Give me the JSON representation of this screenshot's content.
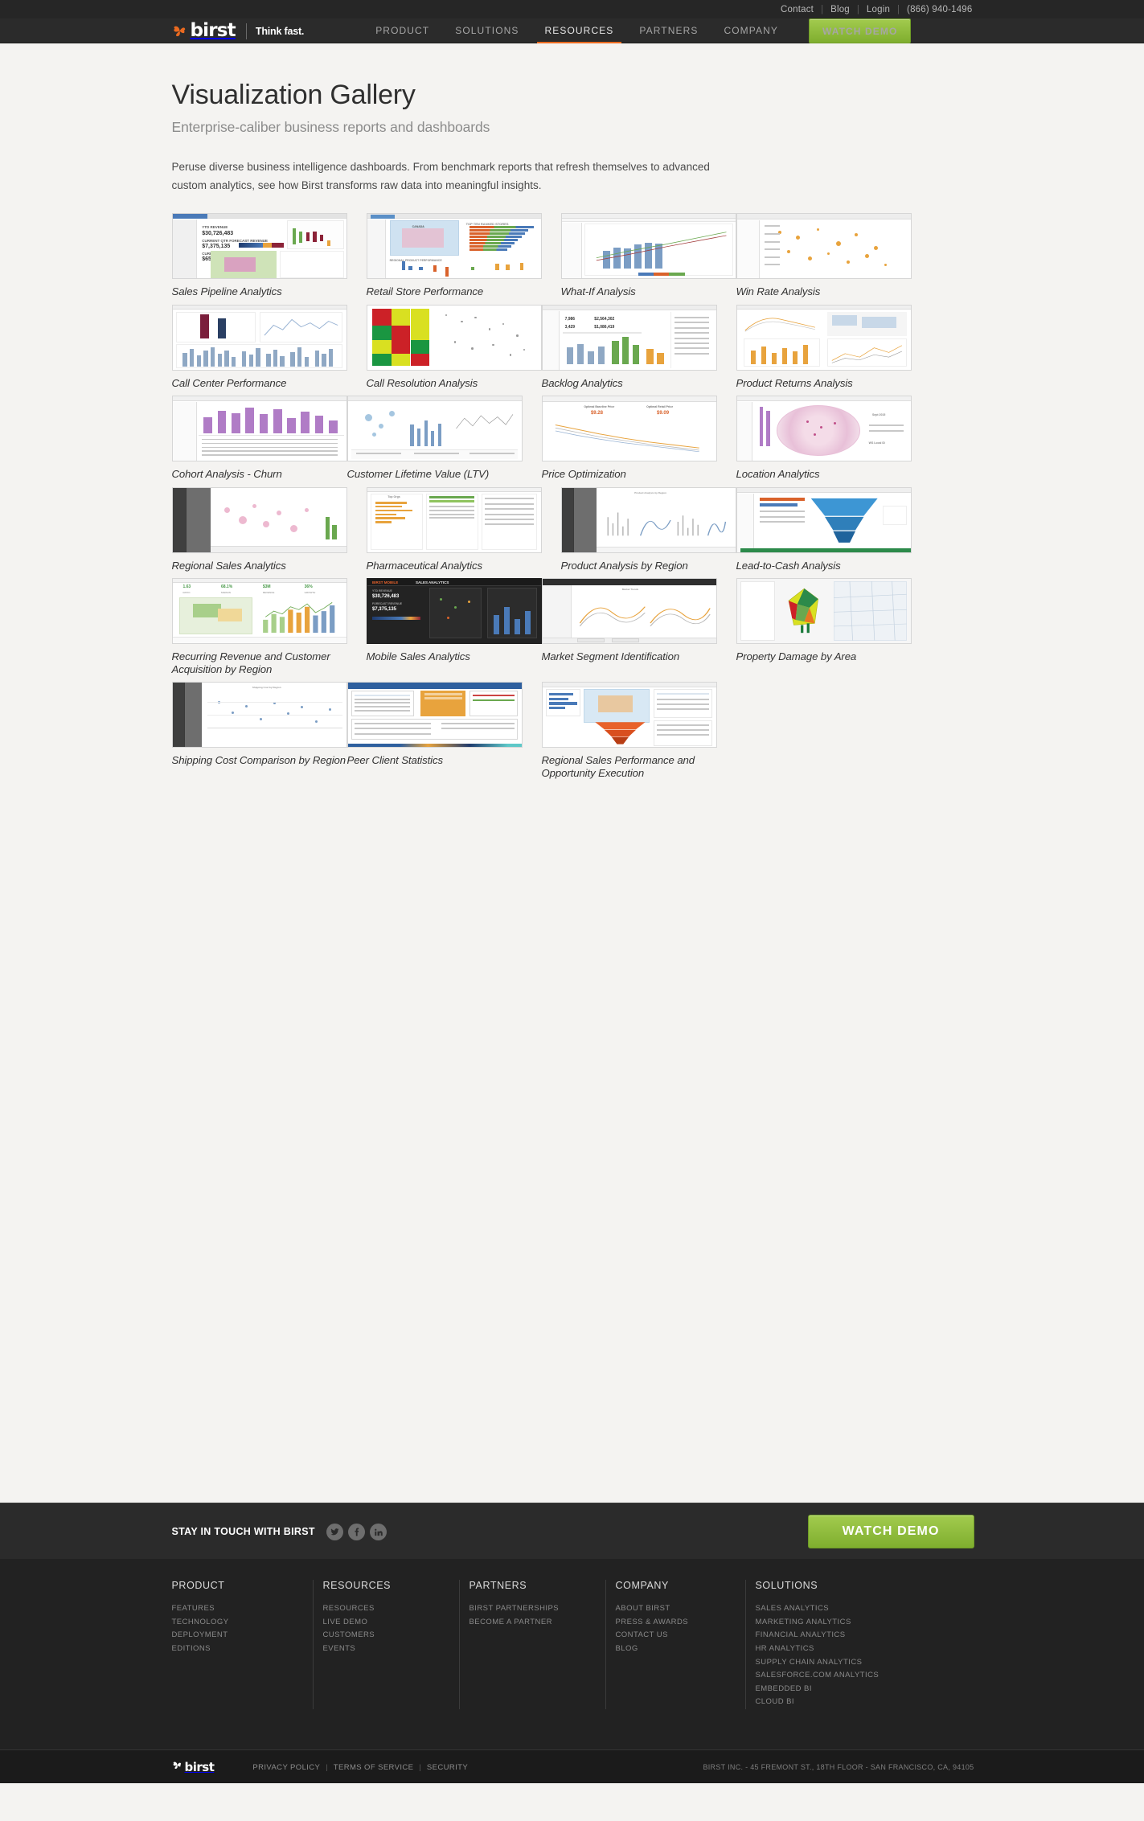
{
  "topbar": {
    "links": [
      {
        "label": "Contact"
      },
      {
        "label": "Blog"
      },
      {
        "label": "Login"
      }
    ],
    "separator": "|",
    "phone": "(866) 940-1496"
  },
  "nav": {
    "brand_word": "birst",
    "tagline": "Think fast.",
    "items": [
      {
        "label": "PRODUCT",
        "active": false
      },
      {
        "label": "SOLUTIONS",
        "active": false
      },
      {
        "label": "RESOURCES",
        "active": true
      },
      {
        "label": "PARTNERS",
        "active": false
      },
      {
        "label": "COMPANY",
        "active": false
      }
    ],
    "cta_label": "WATCH DEMO",
    "accent_color": "#ea6a20",
    "cta_color": "#8fbc3f"
  },
  "page": {
    "title": "Visualization Gallery",
    "subtitle": "Enterprise-caliber business reports and dashboards",
    "intro": "Peruse diverse business intelligence dashboards. From benchmark reports that refresh themselves to advanced custom analytics, see how Birst transforms raw data into meaningful insights."
  },
  "gallery": {
    "items": [
      {
        "caption": "Sales Pipeline Analytics",
        "style": "kpi-map"
      },
      {
        "caption": "Retail Store Performance",
        "style": "map-bars"
      },
      {
        "caption": "What-If Analysis",
        "style": "bars-lines"
      },
      {
        "caption": "Win Rate Analysis",
        "style": "scatter-grid"
      },
      {
        "caption": "Call Center Performance",
        "style": "dual-bars"
      },
      {
        "caption": "Call Resolution Analysis",
        "style": "heatmap"
      },
      {
        "caption": "Backlog Analytics",
        "style": "kpi-bars"
      },
      {
        "caption": "Product Returns Analysis",
        "style": "lines-map"
      },
      {
        "caption": "Cohort Analysis - Churn",
        "style": "purple-bars"
      },
      {
        "caption": "Customer Lifetime Value (LTV)",
        "style": "bubble-bars"
      },
      {
        "caption": "Price Optimization",
        "style": "line-decline"
      },
      {
        "caption": "Location Analytics",
        "style": "pink-radial"
      },
      {
        "caption": "Regional Sales Analytics",
        "style": "pink-map"
      },
      {
        "caption": "Pharmaceutical Analytics",
        "style": "orange-table"
      },
      {
        "caption": "Product Analysis by Region",
        "style": "sparkline-grid"
      },
      {
        "caption": "Lead-to-Cash Analysis",
        "style": "funnel"
      },
      {
        "caption": "Recurring Revenue and Customer Acquisition by Region",
        "style": "green-kpi-map"
      },
      {
        "caption": "Mobile Sales Analytics",
        "style": "mobile-dark"
      },
      {
        "caption": "Market Segment Identification",
        "style": "dark-lines"
      },
      {
        "caption": "Property Damage by Area",
        "style": "3d-map"
      },
      {
        "caption": "Shipping Cost Comparison by Region",
        "style": "scatter-light"
      },
      {
        "caption": "Peer Client Statistics",
        "style": "table-report"
      },
      {
        "caption": "Regional Sales Performance and Opportunity Execution",
        "style": "map-funnel"
      }
    ]
  },
  "footer_cta": {
    "stay_label": "STAY IN TOUCH WITH BIRST",
    "social": [
      {
        "name": "twitter",
        "glyph": "ᴠ"
      },
      {
        "name": "facebook",
        "glyph": "f"
      },
      {
        "name": "linkedin",
        "glyph": "in"
      }
    ],
    "watch_demo_label": "WATCH DEMO"
  },
  "footer": {
    "columns": [
      {
        "heading": "PRODUCT",
        "links": [
          "FEATURES",
          "TECHNOLOGY",
          "DEPLOYMENT",
          "EDITIONS"
        ]
      },
      {
        "heading": "RESOURCES",
        "links": [
          "RESOURCES",
          "LIVE DEMO",
          "CUSTOMERS",
          "EVENTS"
        ]
      },
      {
        "heading": "PARTNERS",
        "links": [
          "BIRST PARTNERSHIPS",
          "BECOME A PARTNER"
        ]
      },
      {
        "heading": "COMPANY",
        "links": [
          "ABOUT BIRST",
          "PRESS & AWARDS",
          "CONTACT US",
          "BLOG"
        ]
      },
      {
        "heading": "SOLUTIONS",
        "links": [
          "SALES ANALYTICS",
          "MARKETING ANALYTICS",
          "FINANCIAL ANALYTICS",
          "HR ANALYTICS",
          "SUPPLY CHAIN ANALYTICS",
          "SALESFORCE.COM ANALYTICS",
          "EMBEDDED BI",
          "CLOUD BI"
        ]
      }
    ]
  },
  "footer_bottom": {
    "brand_word": "birst",
    "links": [
      "PRIVACY POLICY",
      "TERMS OF SERVICE",
      "SECURITY"
    ],
    "separator": "|",
    "address": "BIRST INC. - 45 FREMONT ST., 18TH FLOOR - SAN FRANCISCO, CA, 94105"
  }
}
